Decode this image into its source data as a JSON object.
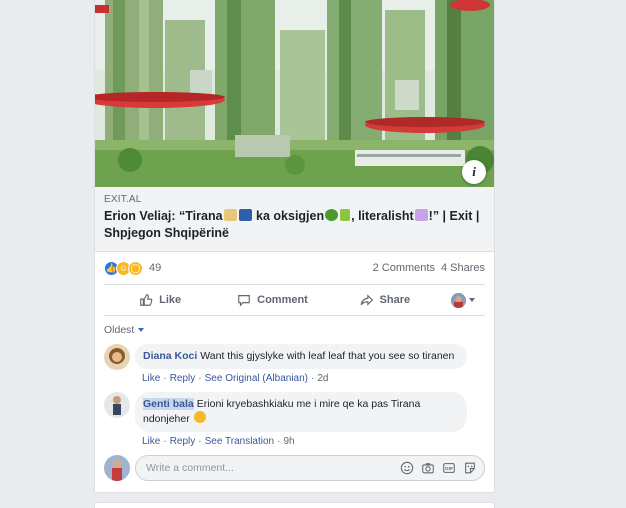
{
  "post": {
    "link": {
      "domain": "EXIT.AL",
      "headline_part1": "Erion Veliaj: “Tirana",
      "headline_part2": " ka oksigjen",
      "headline_part3": ", literalisht",
      "headline_part4": "!” | Exit | Shpjegon Shqipërinë",
      "info_label": "i"
    },
    "stats": {
      "reaction_count": "49",
      "comments": "2 Comments",
      "shares": "4 Shares"
    },
    "actions": {
      "like": "Like",
      "comment": "Comment",
      "share": "Share"
    }
  },
  "comments": {
    "order_label": "Oldest",
    "items": [
      {
        "author": "Diana Koci",
        "text": "Want this gjyslyke with leaf leaf that you see so tiranen",
        "like": "Like",
        "reply": "Reply",
        "translate": "See Original (Albanian)",
        "time": "2d"
      },
      {
        "author": "Genti bala",
        "text": "Erioni kryebashkiaku me i mire qe ka pas Tirana ndonjeher",
        "like": "Like",
        "reply": "Reply",
        "translate": "See Translation",
        "time": "9h"
      }
    ],
    "input_placeholder": "Write a comment..."
  },
  "colors": {
    "accent": "#1877f2",
    "link": "#385898",
    "background": "#e9ebee"
  },
  "icons": [
    "info-icon",
    "like-icon",
    "comment-icon",
    "share-icon",
    "emoji-icon",
    "camera-icon",
    "gif-icon",
    "sticker-icon"
  ]
}
